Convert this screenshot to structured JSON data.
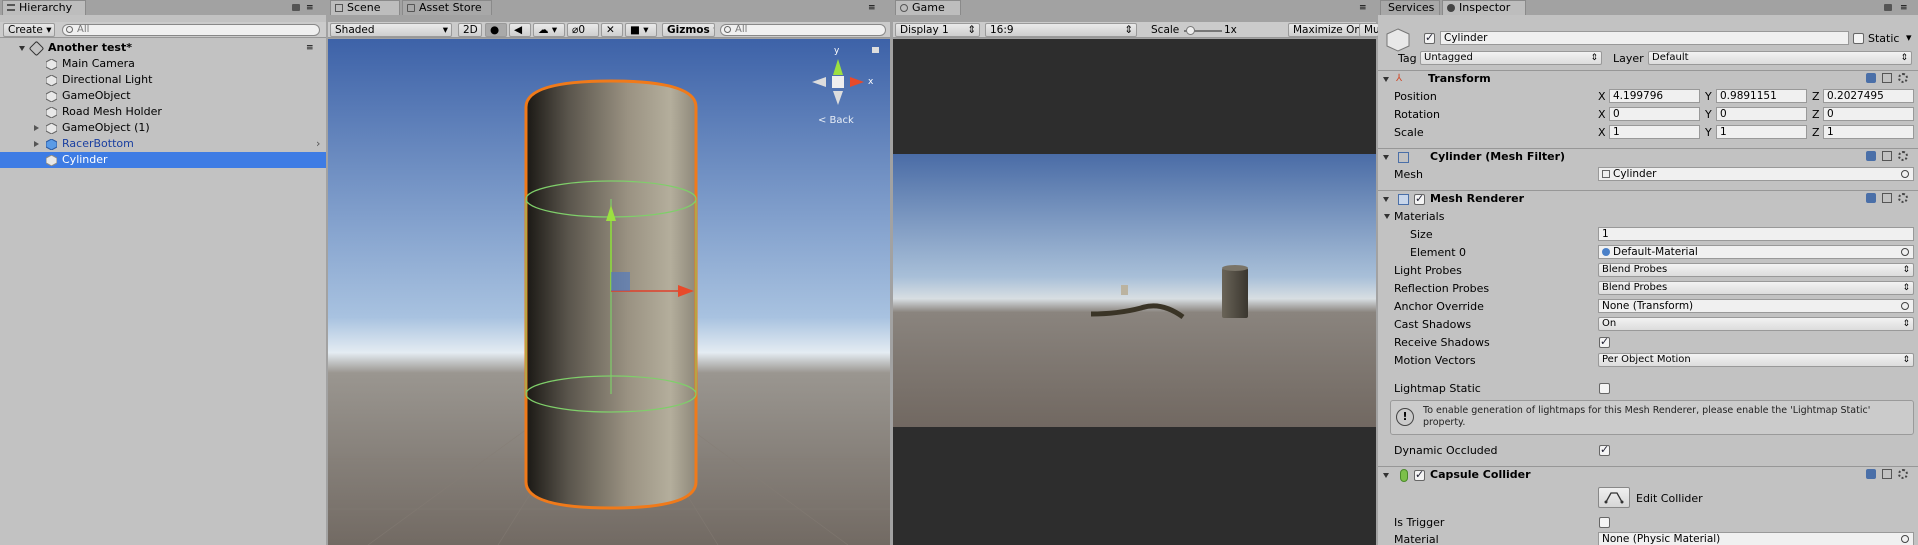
{
  "hierarchy": {
    "tab_label": "Hierarchy",
    "create_label": "Create",
    "search_placeholder": "All",
    "scene_name": "Another test*",
    "items": [
      {
        "label": "Main Camera"
      },
      {
        "label": "Directional Light"
      },
      {
        "label": "GameObject"
      },
      {
        "label": "Road Mesh Holder"
      },
      {
        "label": "GameObject (1)"
      },
      {
        "label": "RacerBottom"
      },
      {
        "label": "Cylinder"
      }
    ]
  },
  "scene": {
    "tabs": [
      "Scene",
      "Asset Store"
    ],
    "shading_mode": "Shaded",
    "mode_2d": "2D",
    "effects_count": "0",
    "gizmos_label": "Gizmos",
    "search_placeholder": "All",
    "gizmo_back_label": "< Back",
    "axis_x": "x",
    "axis_y": "y"
  },
  "game": {
    "tab_label": "Game",
    "display": "Display 1",
    "aspect": "16:9",
    "scale_label": "Scale",
    "scale_value": "1x",
    "maximize_label": "Maximize On Play",
    "mute_label": "Mut"
  },
  "inspector": {
    "tabs": [
      "Services",
      "Inspector"
    ],
    "object_name": "Cylinder",
    "static_label": "Static",
    "tag_label": "Tag",
    "tag_value": "Untagged",
    "layer_label": "Layer",
    "layer_value": "Default",
    "transform": {
      "title": "Transform",
      "position_label": "Position",
      "rotation_label": "Rotation",
      "scale_label": "Scale",
      "position": {
        "x": "4.199796",
        "y": "0.9891151",
        "z": "0.2027495"
      },
      "rotation": {
        "x": "0",
        "y": "0",
        "z": "0"
      },
      "scale": {
        "x": "1",
        "y": "1",
        "z": "1"
      },
      "axis_x": "X",
      "axis_y": "Y",
      "axis_z": "Z"
    },
    "mesh_filter": {
      "title": "Cylinder (Mesh Filter)",
      "mesh_label": "Mesh",
      "mesh_value": "Cylinder"
    },
    "mesh_renderer": {
      "title": "Mesh Renderer",
      "materials_label": "Materials",
      "size_label": "Size",
      "size_value": "1",
      "element0_label": "Element 0",
      "element0_value": "Default-Material",
      "light_probes_label": "Light Probes",
      "light_probes_value": "Blend Probes",
      "reflection_probes_label": "Reflection Probes",
      "reflection_probes_value": "Blend Probes",
      "anchor_override_label": "Anchor Override",
      "anchor_override_value": "None (Transform)",
      "cast_shadows_label": "Cast Shadows",
      "cast_shadows_value": "On",
      "receive_shadows_label": "Receive Shadows",
      "motion_vectors_label": "Motion Vectors",
      "motion_vectors_value": "Per Object Motion",
      "lightmap_static_label": "Lightmap Static",
      "info_text": "To enable generation of lightmaps for this Mesh Renderer, please enable the 'Lightmap Static' property.",
      "dynamic_occluded_label": "Dynamic Occluded"
    },
    "capsule_collider": {
      "title": "Capsule Collider",
      "edit_collider_label": "Edit Collider",
      "is_trigger_label": "Is Trigger",
      "material_label": "Material",
      "material_value": "None (Physic Material)"
    }
  },
  "colors": {
    "selection": "#3e7ce4",
    "selection_outline": "#f07a1a",
    "prefab_text": "#1a3fa0"
  }
}
